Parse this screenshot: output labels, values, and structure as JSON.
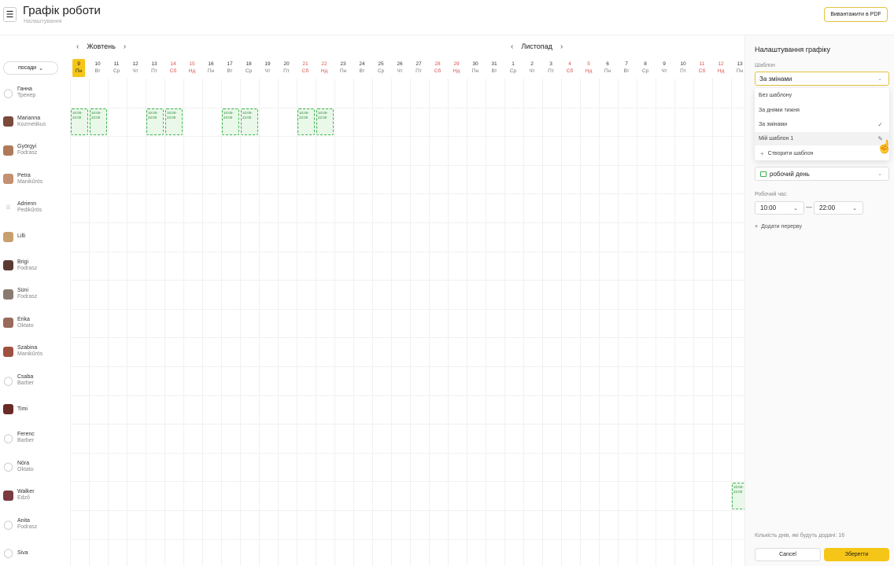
{
  "header": {
    "title": "Графік роботи",
    "subtitle": "Налаштування",
    "pdf_button": "Вивантажити в PDF"
  },
  "filter": {
    "label": "посади"
  },
  "months": {
    "current": "Жовтень",
    "next": "Листопад"
  },
  "days": [
    {
      "d": "9",
      "w": "Пн",
      "weekend": false,
      "today": true
    },
    {
      "d": "10",
      "w": "Вт",
      "weekend": false
    },
    {
      "d": "11",
      "w": "Ср",
      "weekend": false
    },
    {
      "d": "12",
      "w": "Чт",
      "weekend": false
    },
    {
      "d": "13",
      "w": "Пт",
      "weekend": false
    },
    {
      "d": "14",
      "w": "Сб",
      "weekend": true
    },
    {
      "d": "15",
      "w": "Нд",
      "weekend": true
    },
    {
      "d": "16",
      "w": "Пн",
      "weekend": false
    },
    {
      "d": "17",
      "w": "Вт",
      "weekend": false
    },
    {
      "d": "18",
      "w": "Ср",
      "weekend": false
    },
    {
      "d": "19",
      "w": "Чт",
      "weekend": false
    },
    {
      "d": "20",
      "w": "Пт",
      "weekend": false
    },
    {
      "d": "21",
      "w": "Сб",
      "weekend": true
    },
    {
      "d": "22",
      "w": "Нд",
      "weekend": true
    },
    {
      "d": "23",
      "w": "Пн",
      "weekend": false
    },
    {
      "d": "24",
      "w": "Вт",
      "weekend": false
    },
    {
      "d": "25",
      "w": "Ср",
      "weekend": false
    },
    {
      "d": "26",
      "w": "Чт",
      "weekend": false
    },
    {
      "d": "27",
      "w": "Пт",
      "weekend": false
    },
    {
      "d": "28",
      "w": "Сб",
      "weekend": true
    },
    {
      "d": "29",
      "w": "Нд",
      "weekend": true
    },
    {
      "d": "30",
      "w": "Пн",
      "weekend": false
    },
    {
      "d": "31",
      "w": "Вт",
      "weekend": false
    },
    {
      "d": "1",
      "w": "Ср",
      "weekend": false
    },
    {
      "d": "2",
      "w": "Чт",
      "weekend": false
    },
    {
      "d": "3",
      "w": "Пт",
      "weekend": false
    },
    {
      "d": "4",
      "w": "Сб",
      "weekend": true
    },
    {
      "d": "5",
      "w": "Нд",
      "weekend": true
    },
    {
      "d": "6",
      "w": "Пн",
      "weekend": false
    },
    {
      "d": "7",
      "w": "Вт",
      "weekend": false
    },
    {
      "d": "8",
      "w": "Ср",
      "weekend": false
    },
    {
      "d": "9",
      "w": "Чт",
      "weekend": false
    },
    {
      "d": "10",
      "w": "Пт",
      "weekend": false
    },
    {
      "d": "11",
      "w": "Сб",
      "weekend": true
    },
    {
      "d": "12",
      "w": "Нд",
      "weekend": true
    },
    {
      "d": "13",
      "w": "Пн",
      "weekend": false
    }
  ],
  "employees": [
    {
      "name": "Ганна",
      "role": "Тренер",
      "avatar": "empty"
    },
    {
      "name": "Marianna",
      "role": "Kozmetikus",
      "avatar": "photo",
      "color": "#7a4a3a"
    },
    {
      "name": "Györgyi",
      "role": "Fodrasz",
      "avatar": "photo",
      "color": "#b07a5a"
    },
    {
      "name": "Petra",
      "role": "Manikűrös",
      "avatar": "photo",
      "color": "#c49070"
    },
    {
      "name": "Adrienn",
      "role": "Pedikűrös",
      "avatar": "lines"
    },
    {
      "name": "Lilli",
      "role": "",
      "avatar": "photo",
      "color": "#c8a070"
    },
    {
      "name": "Brigi",
      "role": "Fodrasz",
      "avatar": "photo",
      "color": "#5a3a30"
    },
    {
      "name": "Süni",
      "role": "Fodrasz",
      "avatar": "photo",
      "color": "#8a7a70"
    },
    {
      "name": "Erika",
      "role": "Oktato",
      "avatar": "photo",
      "color": "#9a6a5a"
    },
    {
      "name": "Szabina",
      "role": "Manikűrös",
      "avatar": "photo",
      "color": "#a05040"
    },
    {
      "name": "Csaba",
      "role": "Barber",
      "avatar": "empty"
    },
    {
      "name": "Timi",
      "role": "",
      "avatar": "photo",
      "color": "#6a2a25"
    },
    {
      "name": "Ferenc",
      "role": "Barber",
      "avatar": "empty"
    },
    {
      "name": "Nóra",
      "role": "Oktato",
      "avatar": "empty"
    },
    {
      "name": "Walker",
      "role": "Edző",
      "avatar": "photo",
      "color": "#7a3a40"
    },
    {
      "name": "Anita",
      "role": "Fodrasz",
      "avatar": "empty"
    },
    {
      "name": "Siva",
      "role": "",
      "avatar": "empty"
    }
  ],
  "shifts": [
    {
      "row": 1,
      "day": 0,
      "start": "10:00-",
      "end": "22:00"
    },
    {
      "row": 1,
      "day": 1,
      "start": "10:00-",
      "end": "22:00"
    },
    {
      "row": 1,
      "day": 4,
      "start": "10:00-",
      "end": "22:00"
    },
    {
      "row": 1,
      "day": 5,
      "start": "10:00-",
      "end": "22:00"
    },
    {
      "row": 1,
      "day": 8,
      "start": "10:00-",
      "end": "22:00"
    },
    {
      "row": 1,
      "day": 9,
      "start": "10:00-",
      "end": "22:00"
    },
    {
      "row": 1,
      "day": 12,
      "start": "10:00-",
      "end": "22:00"
    },
    {
      "row": 1,
      "day": 13,
      "start": "10:00-",
      "end": "22:00"
    },
    {
      "row": 14,
      "day": 35,
      "start": "10:00-",
      "end": "22:00"
    }
  ],
  "panel": {
    "title": "Налаштування графіку",
    "template_label": "Шаблон",
    "template_value": "За змінами",
    "options": [
      {
        "label": "Без шаблону"
      },
      {
        "label": "За днями тижня"
      },
      {
        "label": "За змінами",
        "selected": true
      },
      {
        "label": "Мій шаблон 1",
        "editable": true
      }
    ],
    "create_label": "Створити шаблон",
    "day_type": "робочий день",
    "work_time_label": "Робочий час",
    "time_from": "10:00",
    "time_to": "22:00",
    "add_break": "Додати перерву",
    "days_count": "Кількість днів, які будуть додані: 16",
    "cancel": "Cancel",
    "save": "Зберегти"
  },
  "colors": {
    "accent": "#f5c518",
    "shift_border": "#3ab54a",
    "shift_bg": "#e9f8e9",
    "weekend": "#d9534f"
  }
}
